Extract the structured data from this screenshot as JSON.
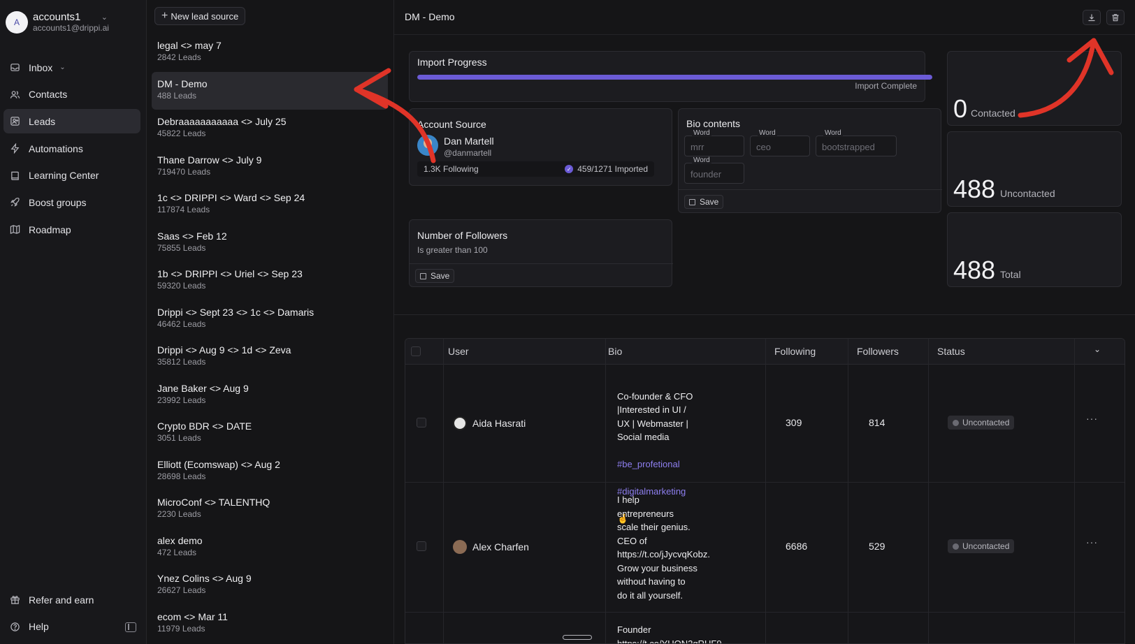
{
  "account": {
    "initial": "A",
    "name": "accounts1",
    "email": "accounts1@drippi.ai"
  },
  "nav": [
    {
      "label": "Inbox",
      "icon": "inbox-icon"
    },
    {
      "label": "Contacts",
      "icon": "contacts-icon"
    },
    {
      "label": "Leads",
      "icon": "leads-icon",
      "active": true
    },
    {
      "label": "Automations",
      "icon": "bolt-icon"
    },
    {
      "label": "Learning Center",
      "icon": "book-icon"
    },
    {
      "label": "Boost groups",
      "icon": "rocket-icon"
    },
    {
      "label": "Roadmap",
      "icon": "map-icon"
    }
  ],
  "bottom_nav": [
    {
      "label": "Refer and earn",
      "icon": "gift-icon"
    },
    {
      "label": "Help",
      "icon": "help-icon"
    }
  ],
  "lead_sources": {
    "new_button": "New lead source",
    "items": [
      {
        "name": "legal <> may 7",
        "count": "2842 Leads"
      },
      {
        "name": "DM - Demo",
        "count": "488 Leads",
        "active": true
      },
      {
        "name": "Debraaaaaaaaaaa <> July 25",
        "count": "45822 Leads"
      },
      {
        "name": "Thane Darrow <> July 9",
        "count": "719470 Leads"
      },
      {
        "name": "1c <> DRIPPI <> Ward <> Sep 24",
        "count": "117874 Leads"
      },
      {
        "name": "Saas <> Feb 12",
        "count": "75855 Leads"
      },
      {
        "name": "1b <> DRIPPI <> Uriel <> Sep 23",
        "count": "59320 Leads"
      },
      {
        "name": "Drippi <> Sept 23 <> 1c <> Damaris",
        "count": "46462 Leads"
      },
      {
        "name": "Drippi <> Aug 9 <> 1d <> Zeva",
        "count": "35812 Leads"
      },
      {
        "name": "Jane Baker <> Aug 9",
        "count": "23992 Leads"
      },
      {
        "name": "Crypto BDR <> DATE",
        "count": "3051 Leads"
      },
      {
        "name": "Elliott (Ecomswap) <> Aug 2",
        "count": "28698 Leads"
      },
      {
        "name": "MicroConf <> TALENTHQ",
        "count": "2230 Leads"
      },
      {
        "name": "alex demo",
        "count": "472 Leads"
      },
      {
        "name": " Ynez Colins <> Aug 9",
        "count": "26627 Leads"
      },
      {
        "name": "ecom <> Mar 11",
        "count": "11979 Leads"
      }
    ]
  },
  "main": {
    "title": "DM - Demo",
    "import": {
      "title": "Import Progress",
      "progress": 1.0,
      "status": "Import Complete"
    },
    "account_source": {
      "title": "Account Source",
      "name": "Dan Martell",
      "handle": "@danmartell",
      "following": "1.3K Following",
      "imported": "459/1271 Imported"
    },
    "bio_contents": {
      "title": "Bio contents",
      "word_label": "Word",
      "words": [
        "mrr",
        "ceo",
        "bootstrapped",
        "founder"
      ],
      "save": "Save"
    },
    "followers_filter": {
      "title": "Number of Followers",
      "condition": "Is greater than 100",
      "save": "Save"
    },
    "stats": [
      {
        "value": "0",
        "label": "Contacted"
      },
      {
        "value": "488",
        "label": "Uncontacted"
      },
      {
        "value": "488",
        "label": "Total"
      }
    ],
    "table": {
      "headers": [
        "User",
        "Bio",
        "Following",
        "Followers",
        "Status"
      ],
      "rows": [
        {
          "user": "Aida Hasrati",
          "bio_text": "Co-founder & CFO\n|Interested in UI /\nUX | Webmaster |\nSocial media",
          "bio_tags": [
            "#be_profetional",
            "#digitalmarketing"
          ],
          "bio_tail": "🤞",
          "following": "309",
          "followers": "814",
          "status": "Uncontacted"
        },
        {
          "user": "Alex Charfen",
          "bio_text": "I help\nentrepreneurs\nscale their genius.\nCEO of\nhttps://t.co/jJycvqKobz.\nGrow your business\nwithout having to\ndo it all yourself.",
          "following": "6686",
          "followers": "529",
          "status": "Uncontacted"
        },
        {
          "bio_text": "Founder\nhttps://t.co/YUON2qRUF9"
        }
      ]
    }
  },
  "colors": {
    "accent": "#6b5bd6",
    "annotation": "#e03428",
    "background": "#151517"
  }
}
